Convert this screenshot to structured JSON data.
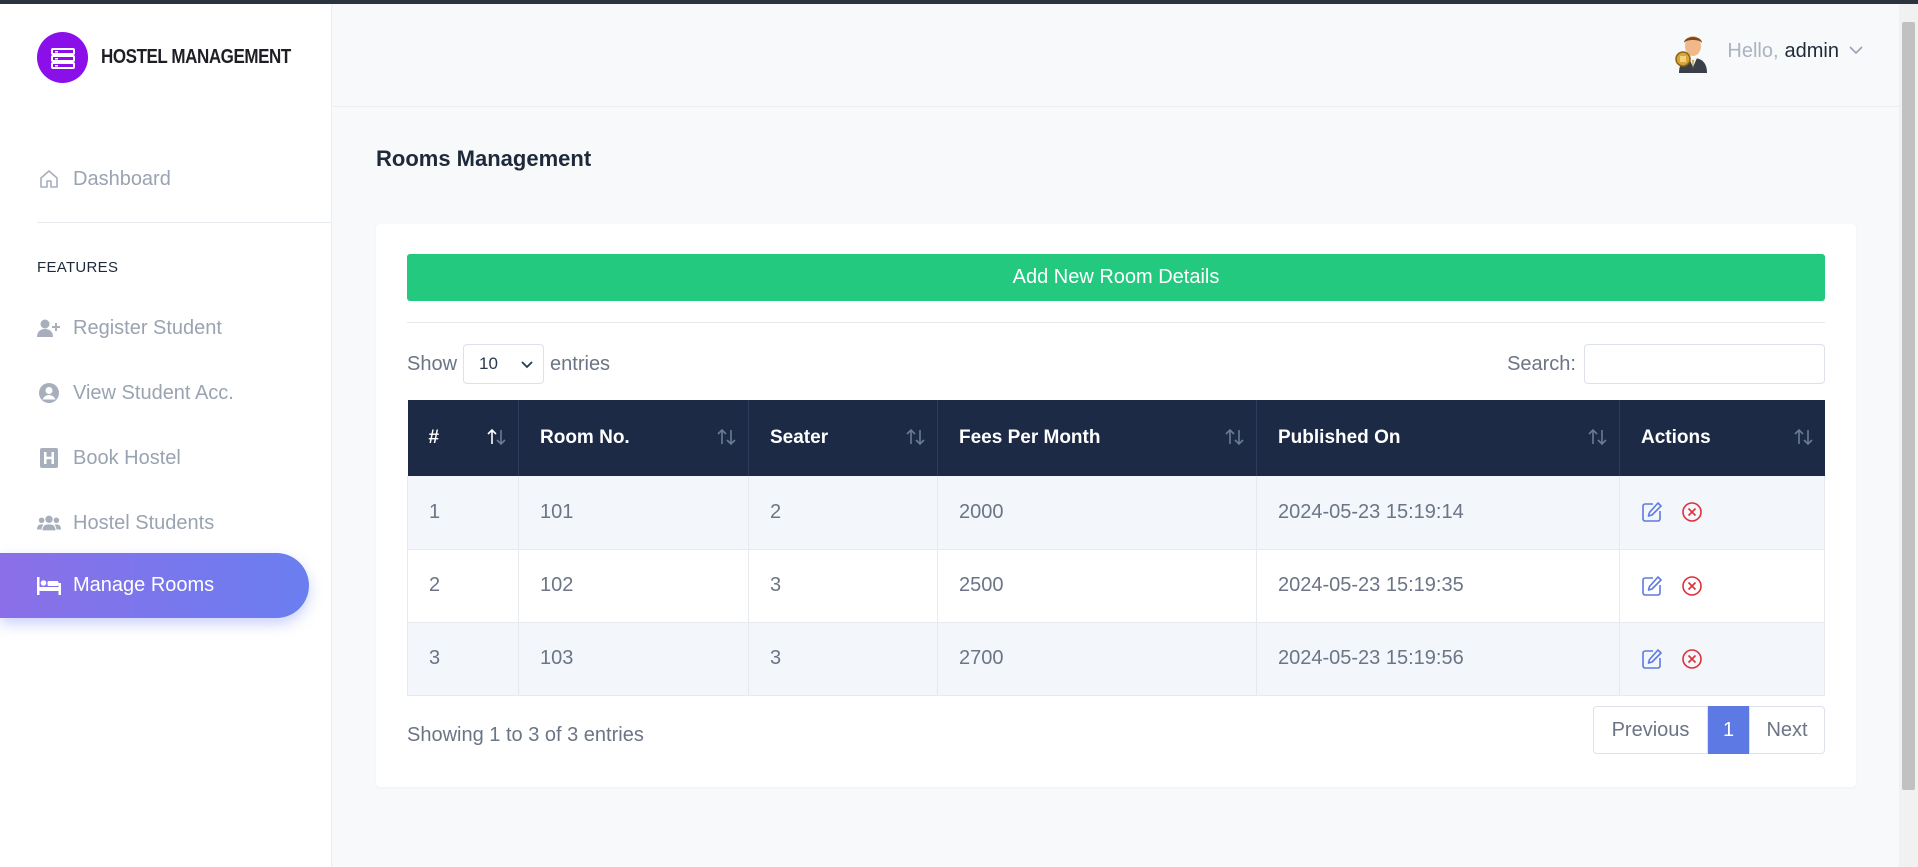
{
  "brand": {
    "name": "HOSTEL MANAGEMENT"
  },
  "sidebar": {
    "dashboard": "Dashboard",
    "section": "FEATURES",
    "items": [
      {
        "label": "Register Student",
        "icon": "user-plus-icon"
      },
      {
        "label": "View Student Acc.",
        "icon": "user-circle-icon"
      },
      {
        "label": "Book Hostel",
        "icon": "hostel-icon"
      },
      {
        "label": "Hostel Students",
        "icon": "users-icon"
      },
      {
        "label": "Manage Rooms",
        "icon": "bed-icon",
        "active": true
      }
    ]
  },
  "header": {
    "greeting": "Hello,",
    "username": "admin"
  },
  "page": {
    "title": "Rooms Management"
  },
  "toolbar": {
    "add_button": "Add New Room Details",
    "show_label": "Show",
    "entries_label": "entries",
    "page_length": "10",
    "search_label": "Search:",
    "search_value": ""
  },
  "table": {
    "columns": [
      "#",
      "Room No.",
      "Seater",
      "Fees Per Month",
      "Published On",
      "Actions"
    ],
    "rows": [
      [
        "1",
        "101",
        "2",
        "2000",
        "2024-05-23 15:19:14"
      ],
      [
        "2",
        "102",
        "3",
        "2500",
        "2024-05-23 15:19:35"
      ],
      [
        "3",
        "103",
        "3",
        "2700",
        "2024-05-23 15:19:56"
      ]
    ]
  },
  "footer": {
    "info": "Showing 1 to 3 of 3 entries",
    "previous": "Previous",
    "current_page": "1",
    "next": "Next"
  },
  "colors": {
    "accent": "#22c97e",
    "table_header": "#1c2a45",
    "active_nav_start": "#8b6fe8",
    "active_nav_end": "#6a7ef0",
    "pager_current": "#5d7ae4",
    "edit_icon": "#5d7ae4",
    "delete_icon": "#e0303a"
  }
}
